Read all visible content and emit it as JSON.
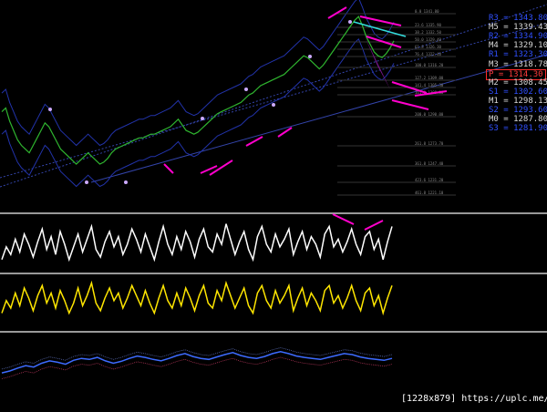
{
  "watermark": "[1228x879] https://uplc.me/",
  "colors": {
    "background": "#000000",
    "price": "#2fb52f",
    "oscillator1": "#ffffff",
    "oscillator2": "#ffe600",
    "oscillator3": "#3d6bff",
    "arrows": "#ff00cc",
    "channel": "#3344aa",
    "pattern_fill": "#8b1aa0",
    "pattern_line": "#33dddd",
    "level_blue": "#3050ff",
    "level_gray": "#d8d8d8",
    "pivot": "#ff3b3b"
  },
  "levels": [
    {
      "label": "R3 = 1343.80",
      "color": "#3050ff"
    },
    {
      "label": "M5 = 1339.43",
      "color": "#d8d8d8"
    },
    {
      "label": "R2 = 1334.90",
      "color": "#3050ff"
    },
    {
      "label": "M4 = 1329.10",
      "color": "#d8d8d8"
    },
    {
      "label": "R1 = 1323.30",
      "color": "#3050ff"
    },
    {
      "label": "M3 = 1318.78",
      "color": "#d8d8d8"
    },
    {
      "label": "P  = 1314.30",
      "color": "#ff3b3b",
      "pivot": true
    },
    {
      "label": "M2 = 1308.45",
      "color": "#d8d8d8"
    },
    {
      "label": "S1 = 1302.60",
      "color": "#3050ff"
    },
    {
      "label": "M1 = 1298.13",
      "color": "#d8d8d8"
    },
    {
      "label": "S2 = 1293.60",
      "color": "#3050ff"
    },
    {
      "label": "M0 = 1287.80",
      "color": "#d8d8d8"
    },
    {
      "label": "S3 = 1281.90",
      "color": "#3050ff"
    }
  ],
  "fib_labels": [
    "0.0  1341.80",
    "23.6  1335.90",
    "38.2  1332.50",
    "50.0  1329.40",
    "61.8  1326.30",
    "76.4  1322.40",
    "100.0 1316.20",
    "127.2 1309.00",
    "141.4 1305.30",
    "161.8 1300.00",
    "261.8 1273.70",
    "200.0 1290.00",
    "361.8 1247.40",
    "423.6 1231.20",
    "461.8 1221.10"
  ],
  "chart_data": [
    {
      "type": "line",
      "title": "",
      "xlabel": "",
      "ylabel": "",
      "ylim": [
        1240,
        1345
      ],
      "grid": false,
      "series": [
        {
          "values": [
            1290,
            1292,
            1285,
            1280,
            1275,
            1272,
            1270,
            1268,
            1272,
            1276,
            1280,
            1284,
            1282,
            1278,
            1274,
            1270,
            1268,
            1266,
            1264,
            1262,
            1264,
            1266,
            1268,
            1266,
            1264,
            1262,
            1263,
            1265,
            1268,
            1270,
            1271,
            1272,
            1273,
            1274,
            1275,
            1276,
            1276,
            1277,
            1278,
            1278,
            1279,
            1280,
            1281,
            1282,
            1284,
            1286,
            1283,
            1280,
            1279,
            1278,
            1279,
            1281,
            1283,
            1285,
            1287,
            1289,
            1290,
            1291,
            1292,
            1293,
            1294,
            1295,
            1297,
            1299,
            1300,
            1302,
            1304,
            1305,
            1306,
            1307,
            1308,
            1309,
            1310,
            1312,
            1314,
            1316,
            1318,
            1320,
            1319,
            1317,
            1315,
            1313,
            1315,
            1318,
            1321,
            1324,
            1327,
            1330,
            1333,
            1336,
            1339,
            1341,
            1336,
            1330,
            1326,
            1322,
            1320,
            1319,
            1321,
            1324,
            1328
          ]
        }
      ]
    },
    {
      "type": "line",
      "title": "",
      "xlabel": "",
      "ylabel": "",
      "ylim": [
        0,
        100
      ],
      "grid": false,
      "series": [
        {
          "values": [
            20,
            45,
            30,
            60,
            35,
            70,
            50,
            25,
            55,
            80,
            40,
            65,
            30,
            75,
            50,
            20,
            45,
            70,
            35,
            60,
            85,
            40,
            25,
            55,
            75,
            45,
            65,
            30,
            50,
            80,
            60,
            35,
            70,
            45,
            20,
            55,
            85,
            50,
            30,
            65,
            40,
            75,
            55,
            25,
            60,
            80,
            45,
            35,
            70,
            50,
            90,
            60,
            30,
            55,
            75,
            40,
            20,
            65,
            85,
            50,
            35,
            70,
            45,
            60,
            80,
            30,
            55,
            75,
            40,
            65,
            50,
            25,
            70,
            85,
            45,
            60,
            35,
            55,
            80,
            50,
            30,
            65,
            75,
            40,
            60,
            20,
            55,
            85
          ]
        }
      ]
    },
    {
      "type": "line",
      "title": "",
      "xlabel": "",
      "ylabel": "",
      "ylim": [
        0,
        100
      ],
      "grid": false,
      "series": [
        {
          "values": [
            30,
            55,
            40,
            70,
            45,
            80,
            60,
            35,
            65,
            85,
            50,
            70,
            40,
            75,
            55,
            30,
            50,
            80,
            45,
            65,
            90,
            50,
            35,
            60,
            80,
            55,
            70,
            40,
            60,
            85,
            65,
            45,
            75,
            50,
            30,
            60,
            85,
            55,
            40,
            70,
            45,
            80,
            60,
            35,
            65,
            85,
            50,
            40,
            75,
            55,
            90,
            65,
            40,
            60,
            80,
            45,
            30,
            70,
            85,
            55,
            40,
            75,
            50,
            65,
            85,
            35,
            60,
            80,
            45,
            70,
            55,
            35,
            75,
            85,
            50,
            65,
            40,
            60,
            85,
            55,
            35,
            70,
            80,
            45,
            65,
            30,
            60,
            85
          ]
        }
      ]
    },
    {
      "type": "line",
      "title": "",
      "xlabel": "",
      "ylabel": "",
      "ylim": [
        0,
        100
      ],
      "grid": false,
      "series": [
        {
          "values": [
            30,
            34,
            40,
            45,
            42,
            50,
            55,
            52,
            48,
            56,
            60,
            58,
            62,
            55,
            50,
            54,
            60,
            65,
            62,
            58,
            55,
            60,
            66,
            70,
            64,
            60,
            58,
            63,
            68,
            72,
            66,
            62,
            60,
            64,
            70,
            74,
            70,
            65,
            62,
            60,
            58,
            62,
            66,
            70,
            68,
            63,
            60,
            58,
            56,
            60
          ]
        }
      ]
    }
  ]
}
